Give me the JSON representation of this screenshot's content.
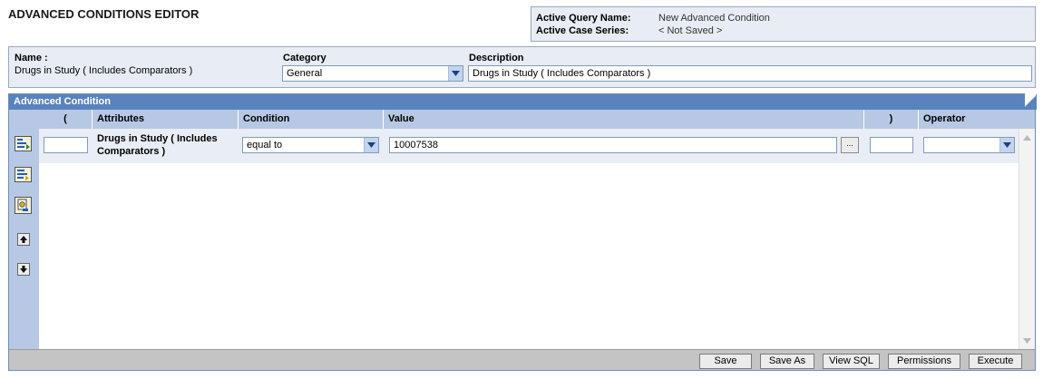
{
  "page": {
    "title": "ADVANCED CONDITIONS EDITOR"
  },
  "query_info": {
    "query_name_label": "Active Query Name:",
    "query_name_value": "New Advanced Condition",
    "case_series_label": "Active Case Series:",
    "case_series_value": "< Not Saved >"
  },
  "name_panel": {
    "name_label": "Name :",
    "name_value": "Drugs in Study ( Includes Comparators )",
    "category_label": "Category",
    "category_value": "General",
    "description_label": "Description",
    "description_value": "Drugs in Study ( Includes Comparators )"
  },
  "advanced_condition": {
    "header": "Advanced Condition",
    "columns": {
      "open_paren": "(",
      "attributes": "Attributes",
      "condition": "Condition",
      "value": "Value",
      "close_paren": ")",
      "operator": "Operator"
    },
    "rows": [
      {
        "open_paren": "",
        "attribute_line1": "Drugs in Study ( Includes",
        "attribute_line2": "Comparators )",
        "condition": "equal to",
        "value": "10007538",
        "lookup_label": "...",
        "close_paren": "",
        "operator": ""
      }
    ],
    "rail_icons": [
      "add-condition-icon",
      "add-group-icon",
      "nested-query-icon",
      "move-up-icon",
      "move-down-icon"
    ]
  },
  "footer": {
    "save": "Save",
    "save_as": "Save As",
    "view_sql": "View SQL",
    "permissions": "Permissions",
    "execute": "Execute"
  },
  "colors": {
    "panel_header": "#5a83bd",
    "column_header": "#b6c8e3",
    "panel_bg": "#e8ecf4"
  }
}
